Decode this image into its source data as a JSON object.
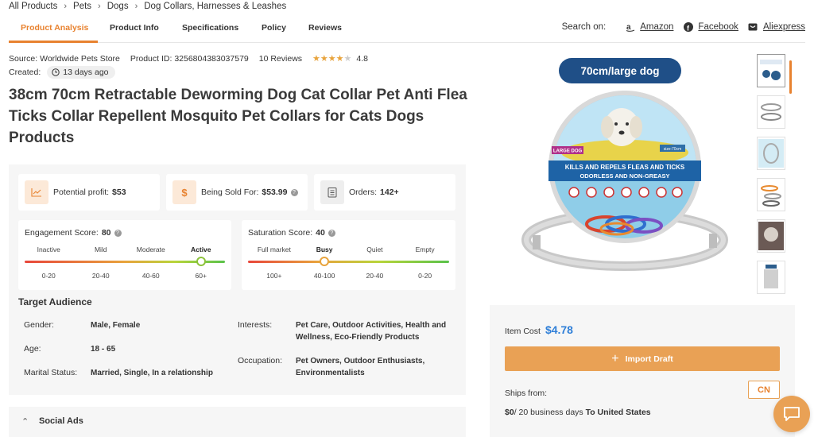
{
  "breadcrumb": [
    "All Products",
    "Pets",
    "Dogs",
    "Dog Collars, Harnesses & Leashes"
  ],
  "tabs": [
    {
      "label": "Product Analysis",
      "active": true
    },
    {
      "label": "Product Info",
      "active": false
    },
    {
      "label": "Specifications",
      "active": false
    },
    {
      "label": "Policy",
      "active": false
    },
    {
      "label": "Reviews",
      "active": false
    }
  ],
  "search_on": {
    "label": "Search on:",
    "links": [
      {
        "label": "Amazon",
        "icon": "amazon-icon"
      },
      {
        "label": "Facebook",
        "icon": "facebook-icon"
      },
      {
        "label": "Aliexpress",
        "icon": "aliexpress-icon"
      }
    ]
  },
  "meta": {
    "source": "Source: Worldwide Pets Store",
    "product_id": "Product ID: 3256804383037579",
    "reviews": "10 Reviews",
    "rating": "4.8",
    "stars_filled": 4,
    "created_label": "Created:",
    "created_value": "13 days ago"
  },
  "title": "38cm 70cm Retractable Deworming Dog Cat Collar Pet Anti Flea Ticks Collar Repellent Mosquito Pet Collars for Cats Dogs Products",
  "stats": {
    "profit_label": "Potential profit:",
    "profit_value": "$53",
    "sold_label": "Being Sold For:",
    "sold_value": "$53.99",
    "orders_label": "Orders:",
    "orders_value": "142+"
  },
  "engagement": {
    "label": "Engagement Score:",
    "value": "80",
    "levels": [
      "Inactive",
      "Mild",
      "Moderate",
      "Active"
    ],
    "ranges": [
      "0-20",
      "20-40",
      "40-60",
      "60+"
    ],
    "active_index": 3
  },
  "saturation": {
    "label": "Saturation Score:",
    "value": "40",
    "levels": [
      "Full market",
      "Busy",
      "Quiet",
      "Empty"
    ],
    "ranges": [
      "100+",
      "40-100",
      "20-40",
      "0-20"
    ],
    "active_index": 1
  },
  "audience": {
    "title": "Target Audience",
    "gender_label": "Gender:",
    "gender_value": "Male, Female",
    "age_label": "Age:",
    "age_value": "18 - 65",
    "marital_label": "Marital Status:",
    "marital_value": "Married, Single, In a relationship",
    "interests_label": "Interests:",
    "interests_value": "Pet Care, Outdoor Activities, Health and Wellness, Eco-Friendly Products",
    "occupation_label": "Occupation:",
    "occupation_value": "Pet Owners, Outdoor Enthusiasts, Environmentalists"
  },
  "social_ads": "Social Ads",
  "product_image": {
    "badge": "70cm/large dog",
    "tag": "LARGE DOG",
    "size_tag": "size:70cm",
    "line1": "KILLS AND REPELS FLEAS AND TICKS",
    "line2": "ODORLESS AND NON-GREASY"
  },
  "price": {
    "item_cost_label": "Item Cost",
    "item_cost_value": "$4.78",
    "import_label": "Import Draft",
    "ships_from_label": "Ships from:",
    "ships_from_country": "CN",
    "shipping_cost": "$0",
    "shipping_days": "/ 20 business days",
    "shipping_dest": "To United States"
  },
  "colors": {
    "accent": "#e8822f",
    "price_blue": "#2f7fd8",
    "button_orange": "#e9a155"
  }
}
